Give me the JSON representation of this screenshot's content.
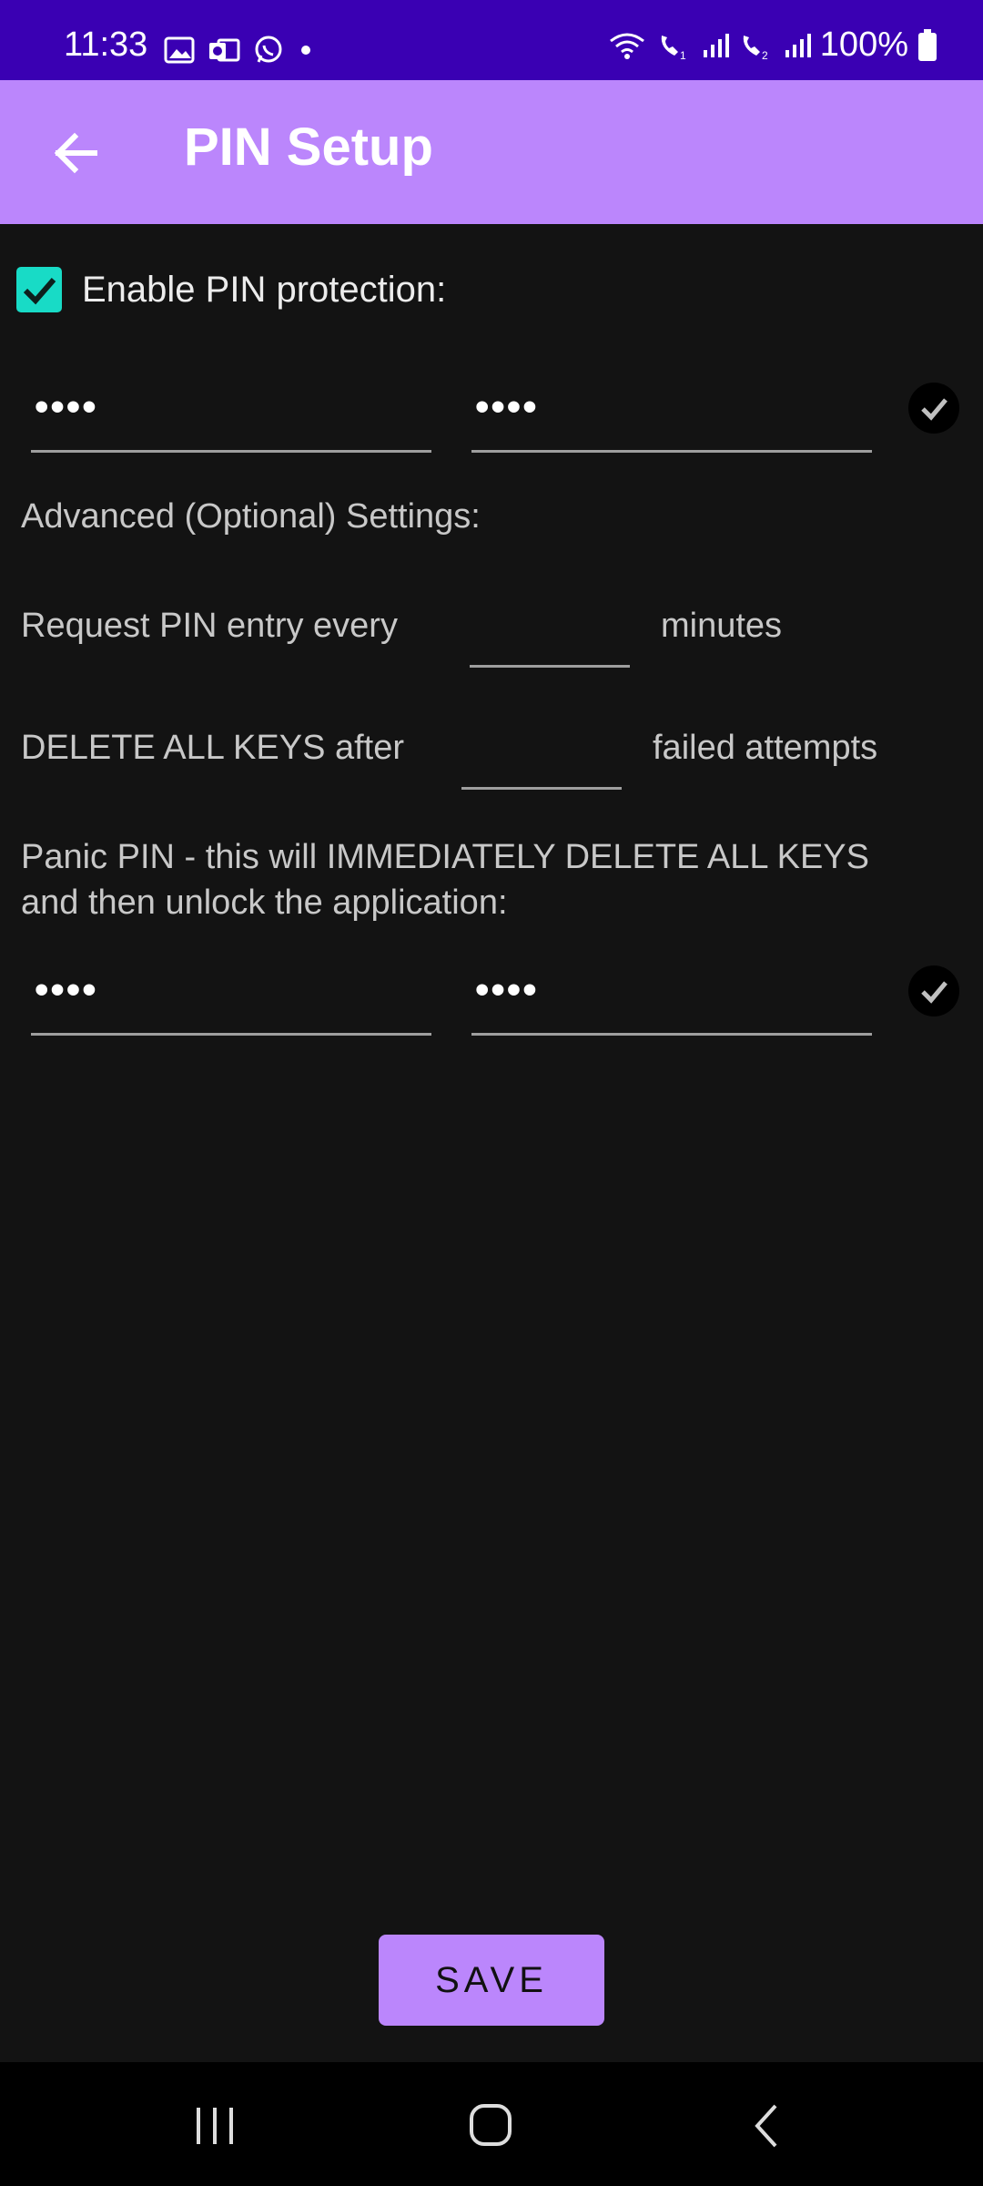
{
  "status_bar": {
    "time": "11:33",
    "battery": "100%",
    "icons_left": [
      "image-icon",
      "outlook-icon",
      "whatsapp-icon",
      "dot-icon"
    ],
    "icons_right": [
      "wifi-icon",
      "call-sim1-icon",
      "signal-icon",
      "call-sim2-icon",
      "signal-icon",
      "battery-icon"
    ]
  },
  "app_bar": {
    "title": "PIN Setup",
    "back_icon": "arrow-left-icon",
    "color": "#bb86fc"
  },
  "enable_pin": {
    "label": "Enable PIN protection:",
    "checked": true,
    "accent": "#18dbc6"
  },
  "pin_fields": {
    "pin_value": "••••",
    "confirm_value": "••••",
    "match_icon": "check-circle-icon"
  },
  "advanced": {
    "heading": "Advanced (Optional) Settings:",
    "request_label": "Request PIN entry every",
    "request_value": "",
    "request_unit": "minutes",
    "delete_label": "DELETE ALL KEYS after",
    "delete_value": "",
    "delete_unit": "failed attempts"
  },
  "panic": {
    "description_line1": "Panic PIN - this will IMMEDIATELY DELETE ALL KEYS",
    "description_line2": "and then unlock the application:",
    "pin_value": "••••",
    "confirm_value": "••••",
    "match_icon": "check-circle-icon"
  },
  "save_label": "SAVE",
  "nav_bar": {
    "recents_icon": "recents-icon",
    "home_icon": "home-icon",
    "back_icon": "back-chevron-icon"
  }
}
